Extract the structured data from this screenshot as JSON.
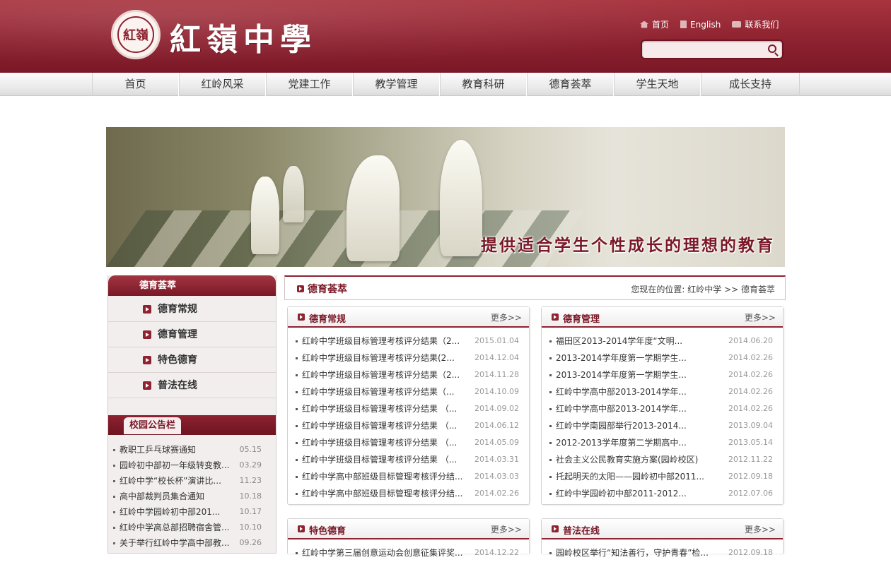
{
  "header": {
    "seal_text": "紅嶺",
    "school_name": "紅嶺中學",
    "toplinks": [
      {
        "label": "首页",
        "icon": "home-icon"
      },
      {
        "label": "English",
        "icon": "document-icon"
      },
      {
        "label": "联系我们",
        "icon": "contact-icon"
      }
    ],
    "search": {
      "placeholder": "",
      "value": ""
    }
  },
  "nav": [
    "首页",
    "红岭风采",
    "党建工作",
    "教学管理",
    "教育科研",
    "德育荟萃",
    "学生天地",
    "成长支持"
  ],
  "banner": {
    "slogan": "提供适合学生个性成长的理想的教育"
  },
  "sidebar": {
    "title": "德育荟萃",
    "menu": [
      "德育常规",
      "德育管理",
      "特色德育",
      "普法在线"
    ],
    "notice_title": "校园公告栏",
    "notices": [
      {
        "title": "教职工乒乓球赛通知",
        "date": "05.15"
      },
      {
        "title": "园岭初中部初一年级转变教...",
        "date": "03.29"
      },
      {
        "title": "红岭中学“校长杯”演讲比...",
        "date": "11.23"
      },
      {
        "title": "高中部裁判员集合通知",
        "date": "10.18"
      },
      {
        "title": "红岭中学园岭初中部201...",
        "date": "10.17"
      },
      {
        "title": "红岭中学高总部招聘宿舍管...",
        "date": "10.10"
      },
      {
        "title": "关于举行红岭中学高中部教...",
        "date": "09.26"
      }
    ]
  },
  "crumb": {
    "title": "德育荟萃",
    "where": "您现在的位置: 红岭中学 >> 德育荟萃"
  },
  "panels": [
    {
      "title": "德育常规",
      "more": "更多>>",
      "items": [
        {
          "title": "红岭中学班级目标管理考核评分结果（2...",
          "date": "2015.01.04"
        },
        {
          "title": "红岭中学班级目标管理考核评分结果(2...",
          "date": "2014.12.04"
        },
        {
          "title": "红岭中学班级目标管理考核评分结果（2...",
          "date": "2014.11.28"
        },
        {
          "title": "红岭中学班级目标管理考核评分结果（...",
          "date": "2014.10.09"
        },
        {
          "title": "红岭中学班级目标管理考核评分结果 （...",
          "date": "2014.09.02"
        },
        {
          "title": "红岭中学班级目标管理考核评分结果 （...",
          "date": "2014.06.12"
        },
        {
          "title": "红岭中学班级目标管理考核评分结果 （...",
          "date": "2014.05.09"
        },
        {
          "title": "红岭中学班级目标管理考核评分结果 （...",
          "date": "2014.03.31"
        },
        {
          "title": "红岭中学高中部班级目标管理考核评分结...",
          "date": "2014.03.03"
        },
        {
          "title": "红岭中学高中部班级目标管理考核评分结...",
          "date": "2014.02.26"
        }
      ]
    },
    {
      "title": "德育管理",
      "more": "更多>>",
      "items": [
        {
          "title": "福田区2013-2014学年度“文明...",
          "date": "2014.06.20"
        },
        {
          "title": "2013-2014学年度第一学期学生...",
          "date": "2014.02.26"
        },
        {
          "title": "2013-2014学年度第一学期学生...",
          "date": "2014.02.26"
        },
        {
          "title": "红岭中学高中部2013-2014学年...",
          "date": "2014.02.26"
        },
        {
          "title": "红岭中学高中部2013-2014学年...",
          "date": "2014.02.26"
        },
        {
          "title": "红岭中学南园部举行2013-2014...",
          "date": "2013.09.04"
        },
        {
          "title": "2012-2013学年度第二学期高中...",
          "date": "2013.05.14"
        },
        {
          "title": "社会主义公民教育实施方案(园岭校区)",
          "date": "2012.11.22"
        },
        {
          "title": "托起明天的太阳——园岭初中部2011...",
          "date": "2012.09.18"
        },
        {
          "title": "红岭中学园岭初中部2011-2012...",
          "date": "2012.07.06"
        }
      ]
    },
    {
      "title": "特色德育",
      "more": "更多>>",
      "items": [
        {
          "title": "红岭中学第三届创意运动会创意征集评奖...",
          "date": "2014.12.22"
        }
      ]
    },
    {
      "title": "普法在线",
      "more": "更多>>",
      "items": [
        {
          "title": "园岭校区举行“知法善行，守护青春”检...",
          "date": "2012.09.18"
        }
      ]
    }
  ],
  "colors": {
    "brand": "#8e2230",
    "brand_dark": "#7a1827"
  }
}
